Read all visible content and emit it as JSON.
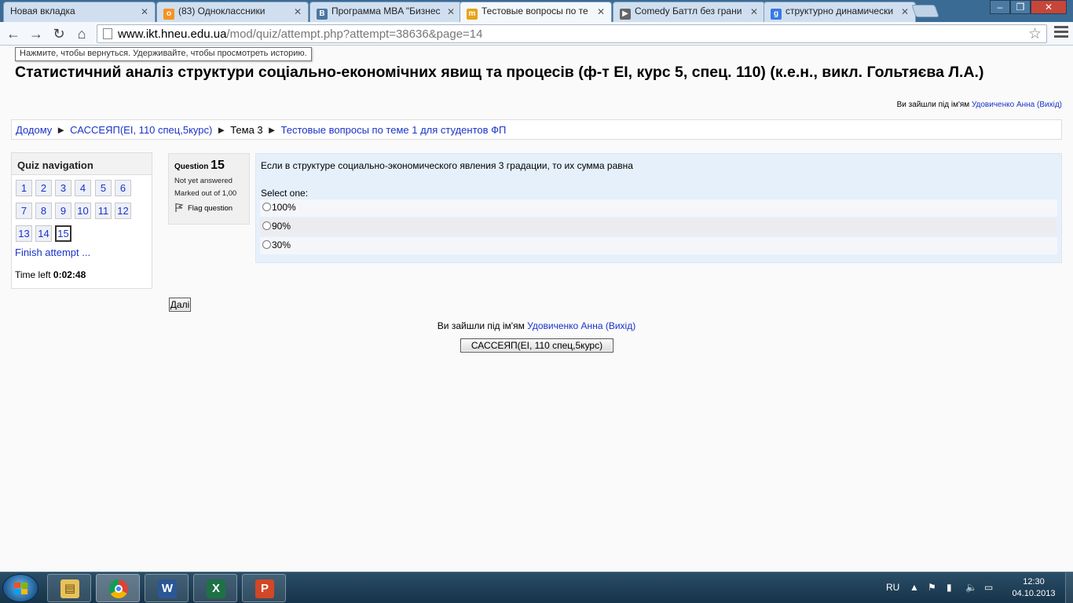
{
  "browser": {
    "tabs": [
      {
        "title": "Новая вкладка",
        "icon": "blank-page-icon",
        "color": "#cfdff0"
      },
      {
        "title": "(83) Одноклассники",
        "icon": "odnoklassniki-icon",
        "color": "#f7931e"
      },
      {
        "title": "Программа MBA \"Бизнес",
        "icon": "vk-icon",
        "color": "#4d76a1"
      },
      {
        "title": "Тестовые вопросы по те",
        "icon": "moodle-icon",
        "color": "#e8a317"
      },
      {
        "title": "Comedy Баттл без грани",
        "icon": "film-icon",
        "color": "#666666"
      },
      {
        "title": "структурно динамически",
        "icon": "google-icon",
        "color": "#3b78e7"
      }
    ],
    "url_host": "www.ikt.hneu.edu.ua",
    "url_path": "/mod/quiz/attempt.php?attempt=38636&page=14",
    "tooltip": "Нажмите, чтобы вернуться. Удерживайте, чтобы просмотреть историю."
  },
  "page": {
    "title": "Статистичний аналіз структури соціально-економічних явищ та процесів (ф-т ЕІ, курс 5, спец. 110) (к.е.н., викл. Гольтяєва Л.А.)",
    "login_prefix": "Ви зайшли під ім'ям",
    "user_name": "Удовиченко Анна",
    "logout": "(Вихід)",
    "breadcrumb": {
      "home": "Додому",
      "course": "САССЕЯП(ЕІ, 110 спец,5курс)",
      "topic": "Тема 3",
      "quiz": "Тестовые вопросы по теме 1 для студентов ФП",
      "separator": "►"
    }
  },
  "quiz_nav": {
    "header": "Quiz navigation",
    "buttons": [
      "1",
      "2",
      "3",
      "4",
      "5",
      "6",
      "7",
      "8",
      "9",
      "10",
      "11",
      "12",
      "13",
      "14",
      "15"
    ],
    "current": "15",
    "finish": "Finish attempt ...",
    "time_label": "Time left",
    "time_value": "0:02:48"
  },
  "question": {
    "label": "Question",
    "number": "15",
    "state": "Not yet answered",
    "marked": "Marked out of 1,00",
    "flag": "Flag question",
    "text": "Если в структуре социально-экономического явления 3 градации, то их сумма равна",
    "select_one": "Select one:",
    "answers": [
      "100%",
      "90%",
      "30%"
    ]
  },
  "next_button": "Далі",
  "course_button": "САССЕЯП(ЕІ, 110 спец,5курс)",
  "taskbar": {
    "apps": [
      "file-explorer-icon",
      "chrome-icon",
      "word-icon",
      "excel-icon",
      "powerpoint-icon"
    ],
    "lang": "RU",
    "time": "12:30",
    "date": "04.10.2013"
  },
  "colors": {
    "link": "#1a33c8",
    "question_bg": "#e6f0fb",
    "taskbar": "#1f3f57"
  }
}
